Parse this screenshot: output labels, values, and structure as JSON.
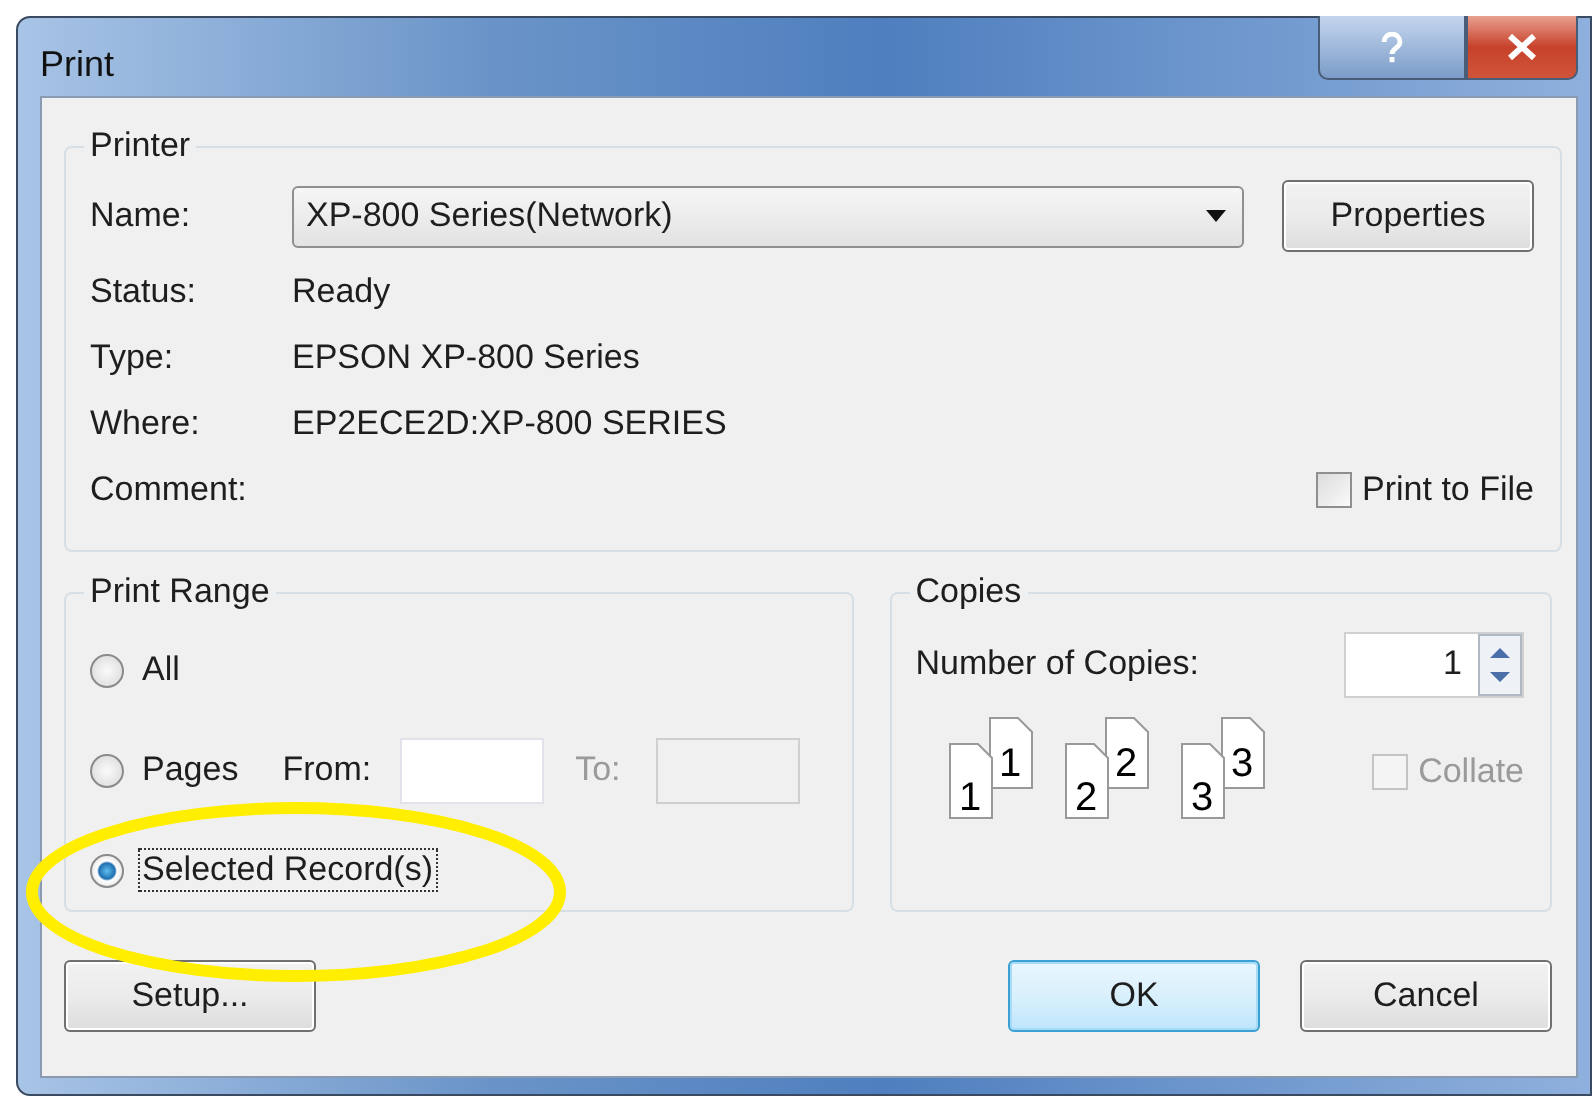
{
  "window": {
    "title": "Print"
  },
  "printer": {
    "legend": "Printer",
    "name_label": "Name:",
    "name_value": "XP-800 Series(Network)",
    "properties_button": "Properties",
    "info": [
      {
        "label": "Status:",
        "value": "Ready"
      },
      {
        "label": "Type:",
        "value": "EPSON XP-800 Series"
      },
      {
        "label": "Where:",
        "value": "EP2ECE2D:XP-800 SERIES"
      },
      {
        "label": "Comment:"
      }
    ],
    "print_to_file": {
      "label": "Print to File",
      "checked": false
    }
  },
  "print_range": {
    "legend": "Print Range",
    "options": [
      {
        "kind": "plain",
        "label": "All",
        "selected": false,
        "focused": false
      },
      {
        "kind": "pages",
        "label": "Pages",
        "selected": false,
        "focused": false,
        "from_label": "From:",
        "to_label": "To:",
        "to_disabled": true
      },
      {
        "kind": "plain",
        "label": "Selected Record(s)",
        "selected": true,
        "focused": true
      }
    ]
  },
  "copies": {
    "legend": "Copies",
    "number_label": "Number of Copies:",
    "number_value": "1",
    "collate_preview": [
      {
        "front": "1",
        "back": "1"
      },
      {
        "front": "2",
        "back": "2"
      },
      {
        "front": "3",
        "back": "3"
      }
    ],
    "collate": {
      "label": "Collate",
      "checked": false,
      "disabled": true
    }
  },
  "setup_button": "Setup...",
  "buttons": [
    {
      "label": "OK",
      "default": true
    },
    {
      "label": "Cancel",
      "default": false
    }
  ]
}
